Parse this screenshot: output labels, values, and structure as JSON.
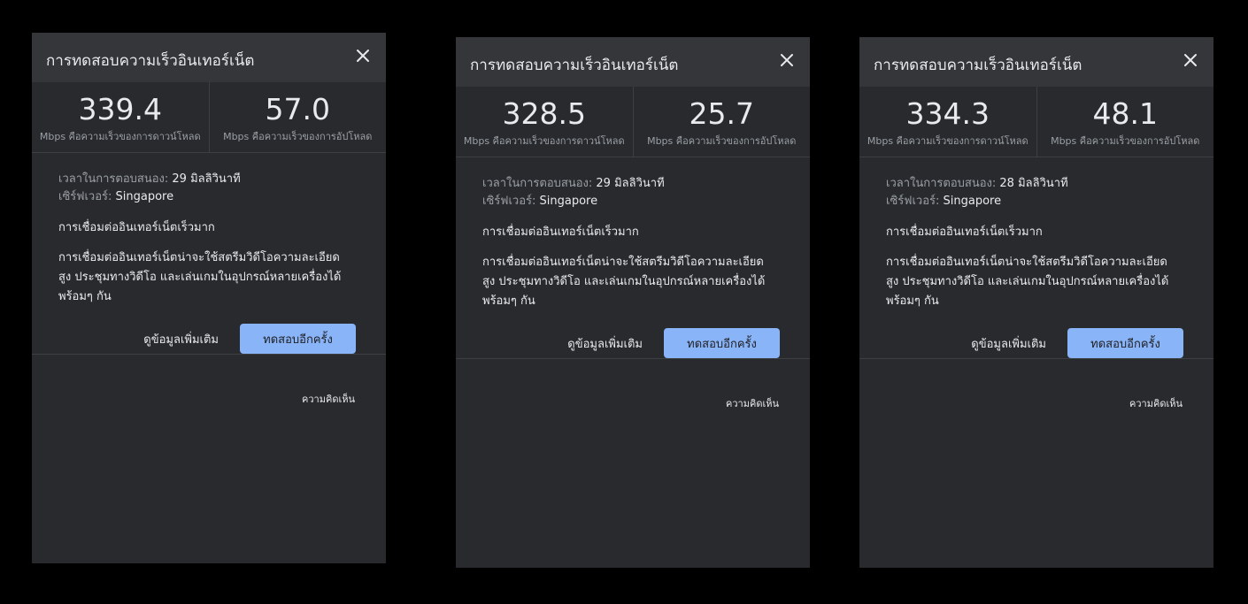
{
  "panels": [
    {
      "title": "การทดสอบความเร็วอินเทอร์เน็ต",
      "download": {
        "value": "339.4",
        "label": "Mbps คือความเร็วของการดาวน์โหลด"
      },
      "upload": {
        "value": "57.0",
        "label": "Mbps คือความเร็วของการอัปโหลด"
      },
      "latency_label": "เวลาในการตอบสนอง:",
      "latency_value": "29 มิลลิวินาที",
      "server_label": "เซิร์ฟเวอร์:",
      "server_value": "Singapore",
      "quality": "การเชื่อมต่ออินเทอร์เน็ตเร็วมาก",
      "description": "การเชื่อมต่ออินเทอร์เน็ตน่าจะใช้สตรีมวิดีโอความละเอียดสูง ประชุมทางวิดีโอ และเล่นเกมในอุปกรณ์หลายเครื่องได้พร้อมๆ กัน",
      "more_info": "ดูข้อมูลเพิ่มเติม",
      "retry": "ทดสอบอีกครั้ง",
      "feedback": "ความคิดเห็น"
    },
    {
      "title": "การทดสอบความเร็วอินเทอร์เน็ต",
      "download": {
        "value": "328.5",
        "label": "Mbps คือความเร็วของการดาวน์โหลด"
      },
      "upload": {
        "value": "25.7",
        "label": "Mbps คือความเร็วของการอัปโหลด"
      },
      "latency_label": "เวลาในการตอบสนอง:",
      "latency_value": "29 มิลลิวินาที",
      "server_label": "เซิร์ฟเวอร์:",
      "server_value": "Singapore",
      "quality": "การเชื่อมต่ออินเทอร์เน็ตเร็วมาก",
      "description": "การเชื่อมต่ออินเทอร์เน็ตน่าจะใช้สตรีมวิดีโอความละเอียดสูง ประชุมทางวิดีโอ และเล่นเกมในอุปกรณ์หลายเครื่องได้พร้อมๆ กัน",
      "more_info": "ดูข้อมูลเพิ่มเติม",
      "retry": "ทดสอบอีกครั้ง",
      "feedback": "ความคิดเห็น"
    },
    {
      "title": "การทดสอบความเร็วอินเทอร์เน็ต",
      "download": {
        "value": "334.3",
        "label": "Mbps คือความเร็วของการดาวน์โหลด"
      },
      "upload": {
        "value": "48.1",
        "label": "Mbps คือความเร็วของการอัปโหลด"
      },
      "latency_label": "เวลาในการตอบสนอง:",
      "latency_value": "28 มิลลิวินาที",
      "server_label": "เซิร์ฟเวอร์:",
      "server_value": "Singapore",
      "quality": "การเชื่อมต่ออินเทอร์เน็ตเร็วมาก",
      "description": "การเชื่อมต่ออินเทอร์เน็ตน่าจะใช้สตรีมวิดีโอความละเอียดสูง ประชุมทางวิดีโอ และเล่นเกมในอุปกรณ์หลายเครื่องได้พร้อมๆ กัน",
      "more_info": "ดูข้อมูลเพิ่มเติม",
      "retry": "ทดสอบอีกครั้ง",
      "feedback": "ความคิดเห็น"
    }
  ],
  "icons": {
    "close": "close-icon"
  },
  "colors": {
    "panel_bg": "#292a2d",
    "header_bg": "#35363a",
    "accent": "#8ab4f8",
    "page_bg": "#000000"
  }
}
